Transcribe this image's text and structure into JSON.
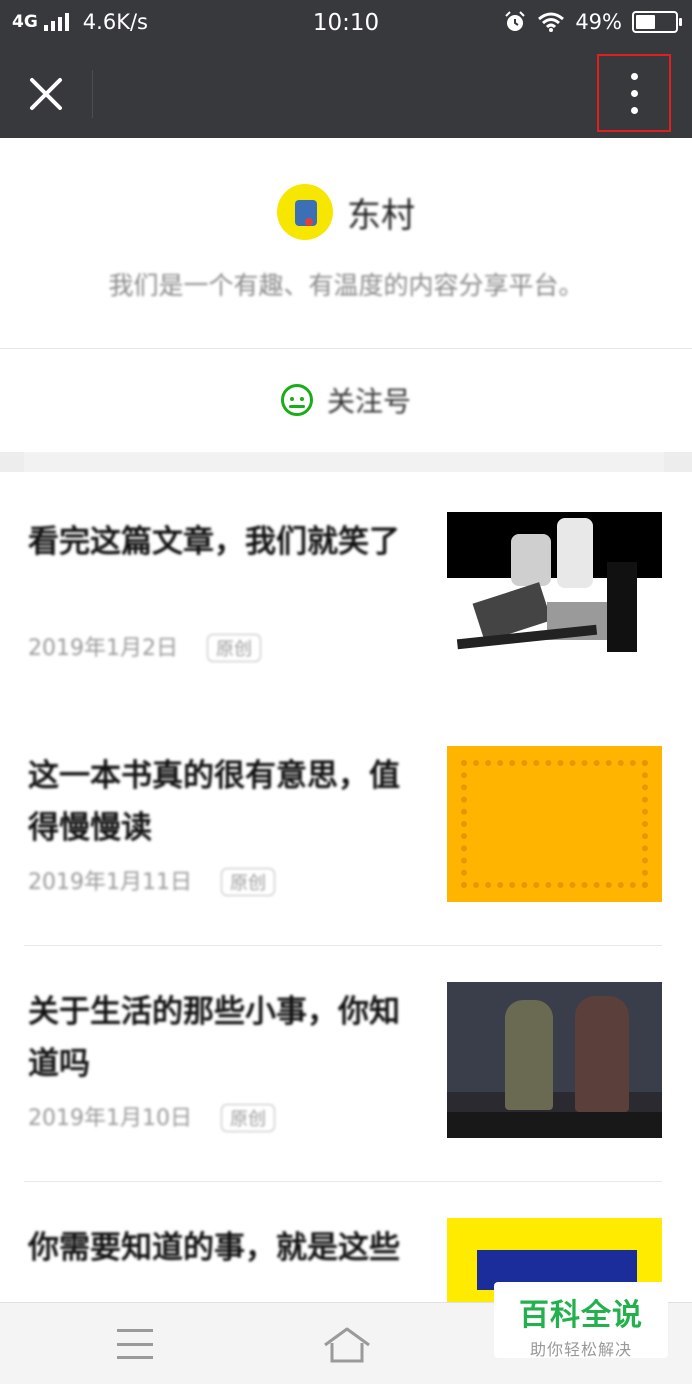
{
  "status_bar": {
    "network": "4G",
    "speed": "4.6K/s",
    "time": "10:10",
    "battery_percent": "49%",
    "battery_level": 0.49,
    "icons": [
      "signal-icon",
      "alarm-icon",
      "wifi-icon",
      "battery-icon"
    ]
  },
  "nav_bar": {
    "close_icon": "close-icon",
    "more_icon": "more-vertical-icon",
    "highlight_color": "#e02020",
    "background": "#38393d"
  },
  "profile": {
    "name": "东村",
    "description": "我们是一个有趣、有温度的内容分享平台。"
  },
  "follow": {
    "label": "关注号",
    "icon": "wechat-face-icon",
    "color": "#1aad19"
  },
  "articles": [
    {
      "title": "看完这篇文章，我们就笑了",
      "date": "2019年1月2日",
      "tag": "原创",
      "thumb": "black-white-photo"
    },
    {
      "title": "这一本书真的很有意思，值得慢慢读",
      "date": "2019年1月11日",
      "tag": "原创",
      "thumb": "orange-pattern"
    },
    {
      "title": "关于生活的那些小事，你知道吗",
      "date": "2019年1月10日",
      "tag": "原创",
      "thumb": "movie-still"
    },
    {
      "title": "你需要知道的事，就是这些",
      "date": "",
      "tag": "",
      "thumb": "yellow-poster"
    }
  ],
  "bottom_nav": {
    "icons": [
      "menu-icon",
      "home-icon"
    ]
  },
  "watermark": {
    "title": "百科全说",
    "subtitle": "助你轻松解决",
    "color": "#22b14c"
  }
}
